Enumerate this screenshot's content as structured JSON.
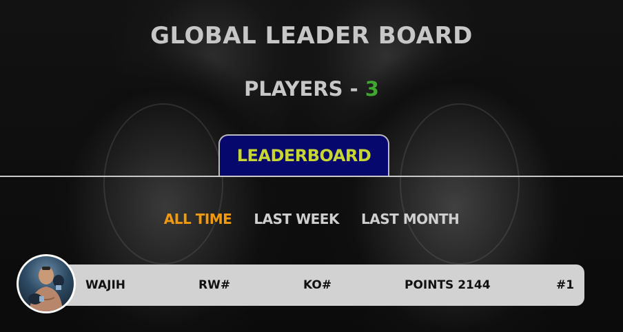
{
  "header": {
    "title": "GLOBAL LEADER BOARD",
    "players_label": "PLAYERS -",
    "players_count": "3"
  },
  "tabs": {
    "active_label": "LEADERBOARD"
  },
  "filters": [
    {
      "label": "ALL TIME",
      "active": true
    },
    {
      "label": "LAST WEEK",
      "active": false
    },
    {
      "label": "LAST MONTH",
      "active": false
    }
  ],
  "leaderboard": [
    {
      "name": "WAJIH",
      "rw": "RW#",
      "ko": "KO#",
      "points": "POINTS 2144",
      "rank": "#1"
    }
  ],
  "colors": {
    "accent_orange": "#f29a0e",
    "tab_bg": "#06086e",
    "tab_text": "#c8d634",
    "count_green": "#3fa630"
  }
}
